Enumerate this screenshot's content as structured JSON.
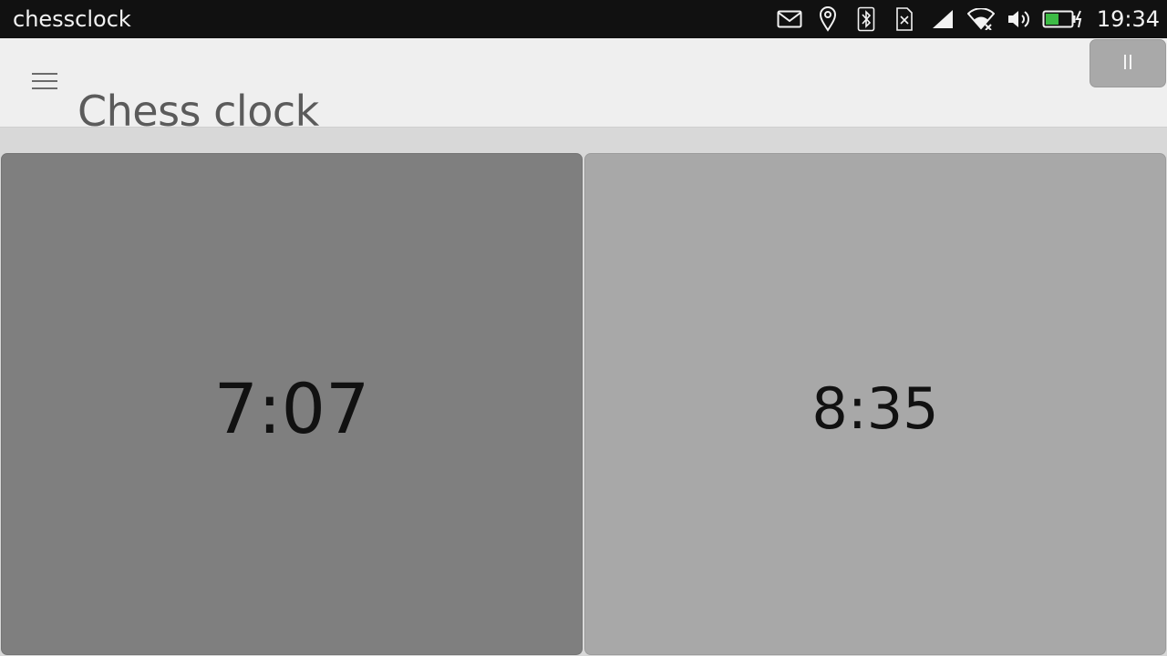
{
  "status_bar": {
    "app_name": "chessclock",
    "time": "19:34",
    "icons": [
      "mail-icon",
      "location-icon",
      "bluetooth-icon",
      "no-sim-icon",
      "cellular-signal-icon",
      "wifi-icon",
      "volume-icon",
      "battery-charging-icon"
    ]
  },
  "header": {
    "title": "Chess clock",
    "menu_icon": "hamburger-menu-icon",
    "pause_icon": "pause-icon"
  },
  "clocks": {
    "left": {
      "time": "7:07",
      "active": true
    },
    "right": {
      "time": "8:35",
      "active": false
    }
  },
  "colors": {
    "status_bar_bg": "#111111",
    "header_bg": "#efefef",
    "active_clock_bg": "#7f7f7f",
    "inactive_clock_bg": "#a8a8a8",
    "battery_fill": "#3dbb45",
    "pause_button_bg": "#a9a9a9"
  }
}
